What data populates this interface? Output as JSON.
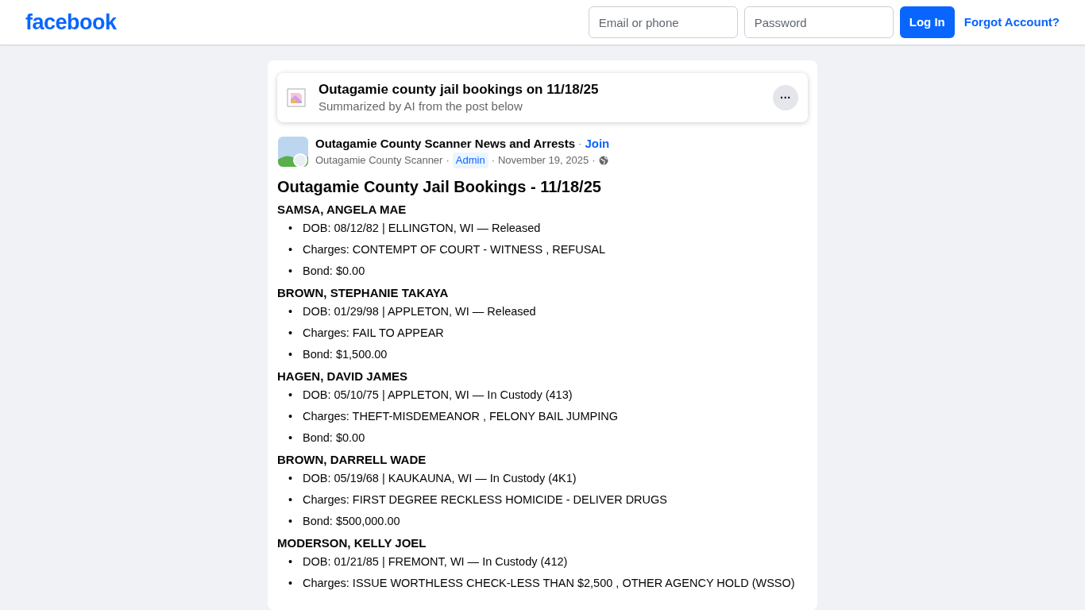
{
  "header": {
    "logo": "facebook",
    "email": {
      "placeholder": "Email or phone"
    },
    "password": {
      "placeholder": "Password"
    },
    "login": "Log In",
    "forgot": "Forgot Account?"
  },
  "summary": {
    "title": "Outagamie county jail bookings on 11/18/25",
    "subtitle": "Summarized by AI from the post below",
    "more": "···"
  },
  "post": {
    "group": "Outagamie County Scanner News and Arrests",
    "join": "Join",
    "author": "Outagamie County Scanner",
    "role": "Admin",
    "date": "November 19, 2025",
    "separator": "·",
    "bullet": "•",
    "title": "Outagamie County Jail Bookings - 11/18/25",
    "bookings": [
      {
        "name": "SAMSA, ANGELA MAE",
        "lines": [
          "DOB: 08/12/82 | ELLINGTON, WI — Released",
          "Charges: CONTEMPT OF COURT - WITNESS , REFUSAL",
          "Bond: $0.00"
        ]
      },
      {
        "name": "BROWN, STEPHANIE TAKAYA",
        "lines": [
          "DOB: 01/29/98 | APPLETON, WI — Released",
          "Charges: FAIL TO APPEAR",
          "Bond: $1,500.00"
        ]
      },
      {
        "name": "HAGEN, DAVID JAMES",
        "lines": [
          "DOB: 05/10/75 | APPLETON, WI — In Custody (413)",
          "Charges: THEFT-MISDEMEANOR , FELONY BAIL JUMPING",
          "Bond: $0.00"
        ]
      },
      {
        "name": "BROWN, DARRELL WADE",
        "lines": [
          "DOB: 05/19/68 | KAUKAUNA, WI — In Custody (4K1)",
          "Charges: FIRST DEGREE RECKLESS HOMICIDE - DELIVER DRUGS",
          "Bond: $500,000.00"
        ]
      },
      {
        "name": "MODERSON, KELLY JOEL",
        "lines": [
          "DOB: 01/21/85 | FREMONT, WI — In Custody (412)",
          "Charges: ISSUE WORTHLESS CHECK-LESS THAN $2,500 , OTHER AGENCY HOLD (WSSO)"
        ]
      }
    ]
  }
}
